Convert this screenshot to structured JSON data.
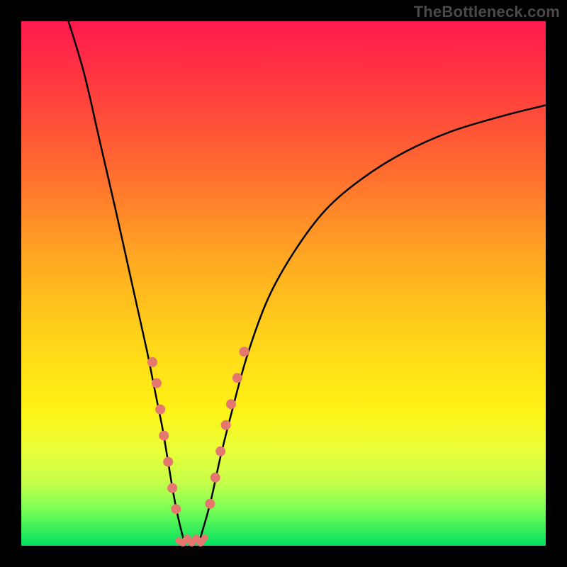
{
  "attribution": "TheBottleneck.com",
  "colors": {
    "background": "#000000",
    "gradient_top": "#ff1a4d",
    "gradient_mid": "#ffd31a",
    "gradient_bottom": "#00e060",
    "curve": "#000000",
    "marker": "#e4776e"
  },
  "chart_data": {
    "type": "line",
    "title": "",
    "xlabel": "",
    "ylabel": "",
    "xlim": [
      0,
      100
    ],
    "ylim": [
      0,
      100
    ],
    "series": [
      {
        "name": "left-curve",
        "x": [
          9,
          12,
          15,
          18,
          20,
          22,
          24,
          25,
          26,
          27,
          28,
          29,
          30,
          31
        ],
        "y": [
          100,
          90,
          77,
          64,
          55,
          46,
          37,
          32,
          27,
          22,
          16,
          10,
          5,
          1
        ]
      },
      {
        "name": "right-curve",
        "x": [
          34,
          36,
          38,
          40,
          43,
          47,
          52,
          58,
          65,
          73,
          82,
          92,
          100
        ],
        "y": [
          1,
          8,
          17,
          25,
          36,
          47,
          56,
          64,
          70,
          75,
          79,
          82,
          84
        ]
      }
    ],
    "markers_left": [
      {
        "x": 25.0,
        "y": 35
      },
      {
        "x": 25.8,
        "y": 31
      },
      {
        "x": 26.5,
        "y": 26
      },
      {
        "x": 27.2,
        "y": 21
      },
      {
        "x": 28.0,
        "y": 16
      },
      {
        "x": 28.8,
        "y": 11
      },
      {
        "x": 29.5,
        "y": 7
      }
    ],
    "markers_right": [
      {
        "x": 36.0,
        "y": 8
      },
      {
        "x": 37.0,
        "y": 13
      },
      {
        "x": 38.0,
        "y": 18
      },
      {
        "x": 39.0,
        "y": 23
      },
      {
        "x": 40.0,
        "y": 27
      },
      {
        "x": 41.2,
        "y": 32
      },
      {
        "x": 42.5,
        "y": 37
      }
    ],
    "bottom_marker_range": {
      "x_start": 30,
      "x_end": 35,
      "y": 1
    }
  }
}
